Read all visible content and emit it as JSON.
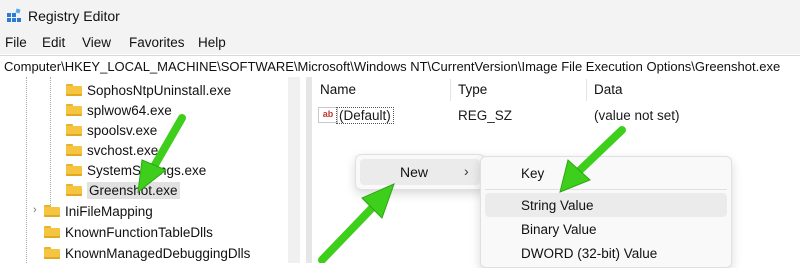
{
  "window": {
    "title": "Registry Editor"
  },
  "menu": [
    "File",
    "Edit",
    "View",
    "Favorites",
    "Help"
  ],
  "address": "Computer\\HKEY_LOCAL_MACHINE\\SOFTWARE\\Microsoft\\Windows NT\\CurrentVersion\\Image File Execution Options\\Greenshot.exe",
  "tree": {
    "items": [
      {
        "label": "SophosNtpUninstall.exe",
        "selected": false
      },
      {
        "label": "splwow64.exe",
        "selected": false
      },
      {
        "label": "spoolsv.exe",
        "selected": false
      },
      {
        "label": "svchost.exe",
        "selected": false
      },
      {
        "label": "SystemSettings.exe",
        "selected": false
      },
      {
        "label": "Greenshot.exe",
        "selected": true
      },
      {
        "label": "IniFileMapping",
        "selected": false,
        "expandable": true
      },
      {
        "label": "KnownFunctionTableDlls",
        "selected": false
      },
      {
        "label": "KnownManagedDebuggingDlls",
        "selected": false
      }
    ]
  },
  "list": {
    "columns": [
      "Name",
      "Type",
      "Data"
    ],
    "rows": [
      {
        "icon": "ab",
        "name": "(Default)",
        "type": "REG_SZ",
        "data": "(value not set)"
      }
    ]
  },
  "context_menu": {
    "new_label": "New",
    "chevron": "›"
  },
  "submenu": {
    "items": [
      "Key",
      "String Value",
      "Binary Value",
      "DWORD (32-bit) Value"
    ],
    "highlighted": "String Value"
  },
  "colors": {
    "arrow": "#3ecf1c",
    "folder": "#f5c542",
    "selection": "#e1e1e1"
  }
}
